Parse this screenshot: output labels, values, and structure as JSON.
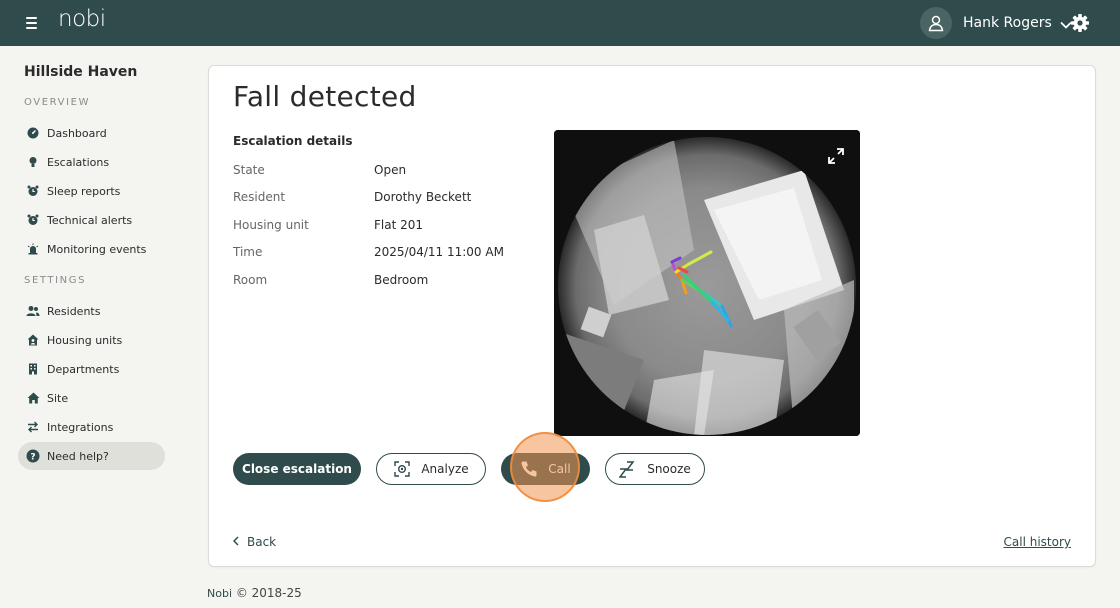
{
  "header": {
    "app_name": "nobi",
    "menu_icon": "hamburger-menu-icon",
    "user_icon": "user-avatar-icon",
    "user_name": "Hank Rogers",
    "settings_icon": "gear-icon"
  },
  "sidebar": {
    "site_name": "Hillside Haven",
    "overview_label": "OVERVIEW",
    "settings_label": "SETTINGS",
    "overview_items": [
      {
        "label": "Dashboard",
        "icon": "dashboard-icon"
      },
      {
        "label": "Escalations",
        "icon": "bulb-icon"
      },
      {
        "label": "Sleep reports",
        "icon": "alarm-clock-icon"
      },
      {
        "label": "Technical alerts",
        "icon": "alarm-clock-icon"
      },
      {
        "label": "Monitoring events",
        "icon": "alarm-icon"
      }
    ],
    "settings_items": [
      {
        "label": "Residents",
        "icon": "people-icon"
      },
      {
        "label": "Housing units",
        "icon": "house-user-icon"
      },
      {
        "label": "Departments",
        "icon": "building-icon"
      },
      {
        "label": "Site",
        "icon": "home-icon"
      },
      {
        "label": "Integrations",
        "icon": "swap-arrows-icon"
      }
    ],
    "help": {
      "label": "Need help?",
      "icon": "help-icon"
    }
  },
  "main": {
    "title": "Fall detected",
    "details_heading": "Escalation details",
    "details": [
      {
        "key": "State",
        "value": "Open"
      },
      {
        "key": "Resident",
        "value": "Dorothy Beckett"
      },
      {
        "key": "Housing unit",
        "value": "Flat 201"
      },
      {
        "key": "Time",
        "value": "2025/04/11 11:00 AM"
      },
      {
        "key": "Room",
        "value": "Bedroom"
      }
    ],
    "camera_icon": "expand-icon",
    "buttons": {
      "close_escalation": "Close escalation",
      "analyze": "Analyze",
      "call": "Call",
      "snooze": "Snooze"
    },
    "back_label": "Back",
    "call_history_label": "Call history"
  },
  "footer": {
    "brand": "Nobi",
    "copyright": "© 2018-25"
  },
  "colors": {
    "primary": "#2f4b4c",
    "background": "#f4f4f1",
    "highlight": "#f0964f"
  }
}
